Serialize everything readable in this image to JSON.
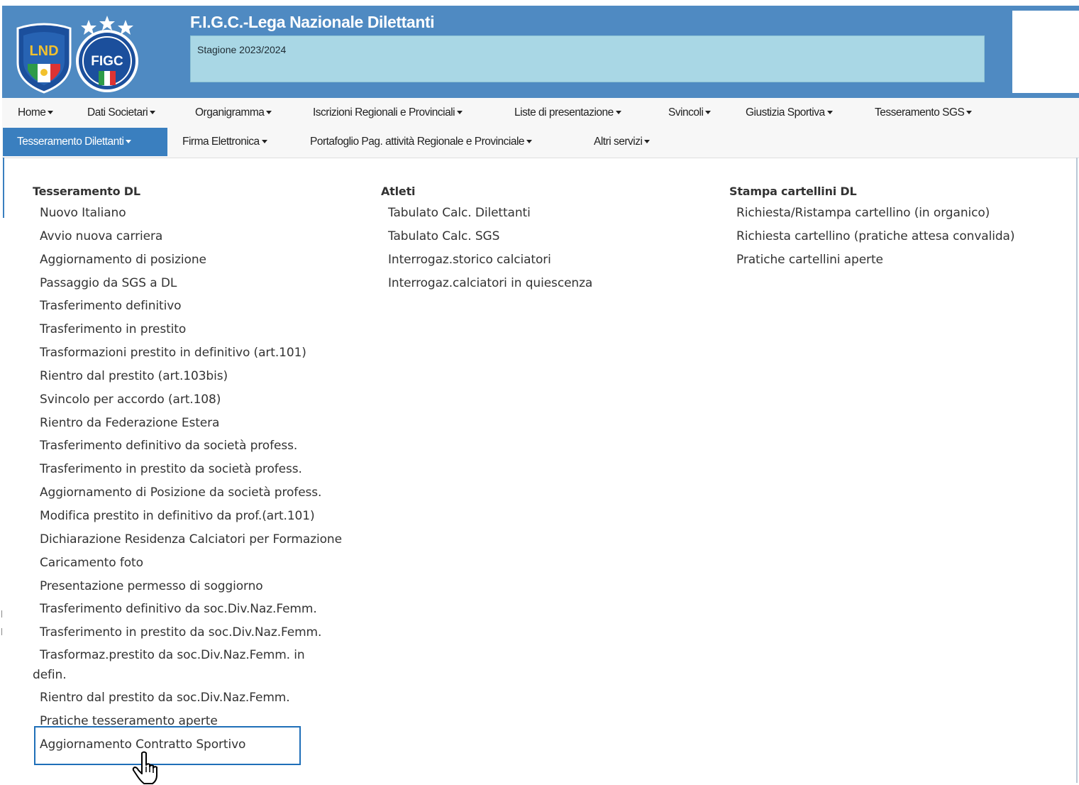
{
  "header": {
    "title": "F.I.G.C.-Lega Nazionale Dilettanti",
    "season": "Stagione 2023/2024",
    "logo_lnd_text": "LND",
    "logo_figc_text": "FIGC",
    "colors": {
      "header_bg": "#4f8ac2",
      "season_bg": "#a9d7e5",
      "active_nav": "#3a7fbf"
    }
  },
  "nav": {
    "row1": [
      {
        "label": "Home"
      },
      {
        "label": "Dati Societari"
      },
      {
        "label": "Organigramma"
      },
      {
        "label": "Iscrizioni Regionali e Provinciali"
      },
      {
        "label": "Liste di presentazione"
      },
      {
        "label": "Svincoli"
      },
      {
        "label": "Giustizia Sportiva"
      },
      {
        "label": "Tesseramento SGS"
      }
    ],
    "row2": [
      {
        "label": "Tesseramento Dilettanti",
        "active": true
      },
      {
        "label": "Firma Elettronica"
      },
      {
        "label": "Portafoglio Pag. attività Regionale e Provinciale"
      },
      {
        "label": "Altri servizi"
      }
    ]
  },
  "dropdown": {
    "columns": [
      {
        "title": "Tesseramento DL",
        "items": [
          "Nuovo Italiano",
          "Avvio nuova carriera",
          "Aggiornamento di posizione",
          "Passaggio da SGS a DL",
          "Trasferimento definitivo",
          "Trasferimento in prestito",
          "Trasformazioni prestito in definitivo (art.101)",
          "Rientro dal prestito (art.103bis)",
          "Svincolo per accordo (art.108)",
          "Rientro da Federazione Estera",
          "Trasferimento definitivo da società profess.",
          "Trasferimento in prestito da società profess.",
          "Aggiornamento di Posizione da società profess.",
          "Modifica prestito in definitivo da prof.(art.101)",
          "Dichiarazione Residenza Calciatori per Formazione",
          "Caricamento foto",
          "Presentazione permesso di soggiorno",
          "Trasferimento definitivo da soc.Div.Naz.Femm.",
          "Trasferimento in prestito da soc.Div.Naz.Femm.",
          "Trasformaz.prestito da soc.Div.Naz.Femm. in defin.",
          "Rientro dal prestito da soc.Div.Naz.Femm.",
          "Pratiche tesseramento aperte",
          "Aggiornamento Contratto Sportivo"
        ]
      },
      {
        "title": "Atleti",
        "items": [
          "Tabulato Calc. Dilettanti",
          "Tabulato Calc. SGS",
          "Interrogaz.storico calciatori",
          "Interrogaz.calciatori in quiescenza"
        ]
      },
      {
        "title": "Stampa cartellini DL",
        "items": [
          "Richiesta/Ristampa cartellino (in organico)",
          "Richiesta cartellino (pratiche attesa convalida)",
          "Pratiche cartellini aperte"
        ]
      }
    ]
  },
  "cursor": "hand-pointer-icon",
  "highlight_color": "#1f6fb8"
}
